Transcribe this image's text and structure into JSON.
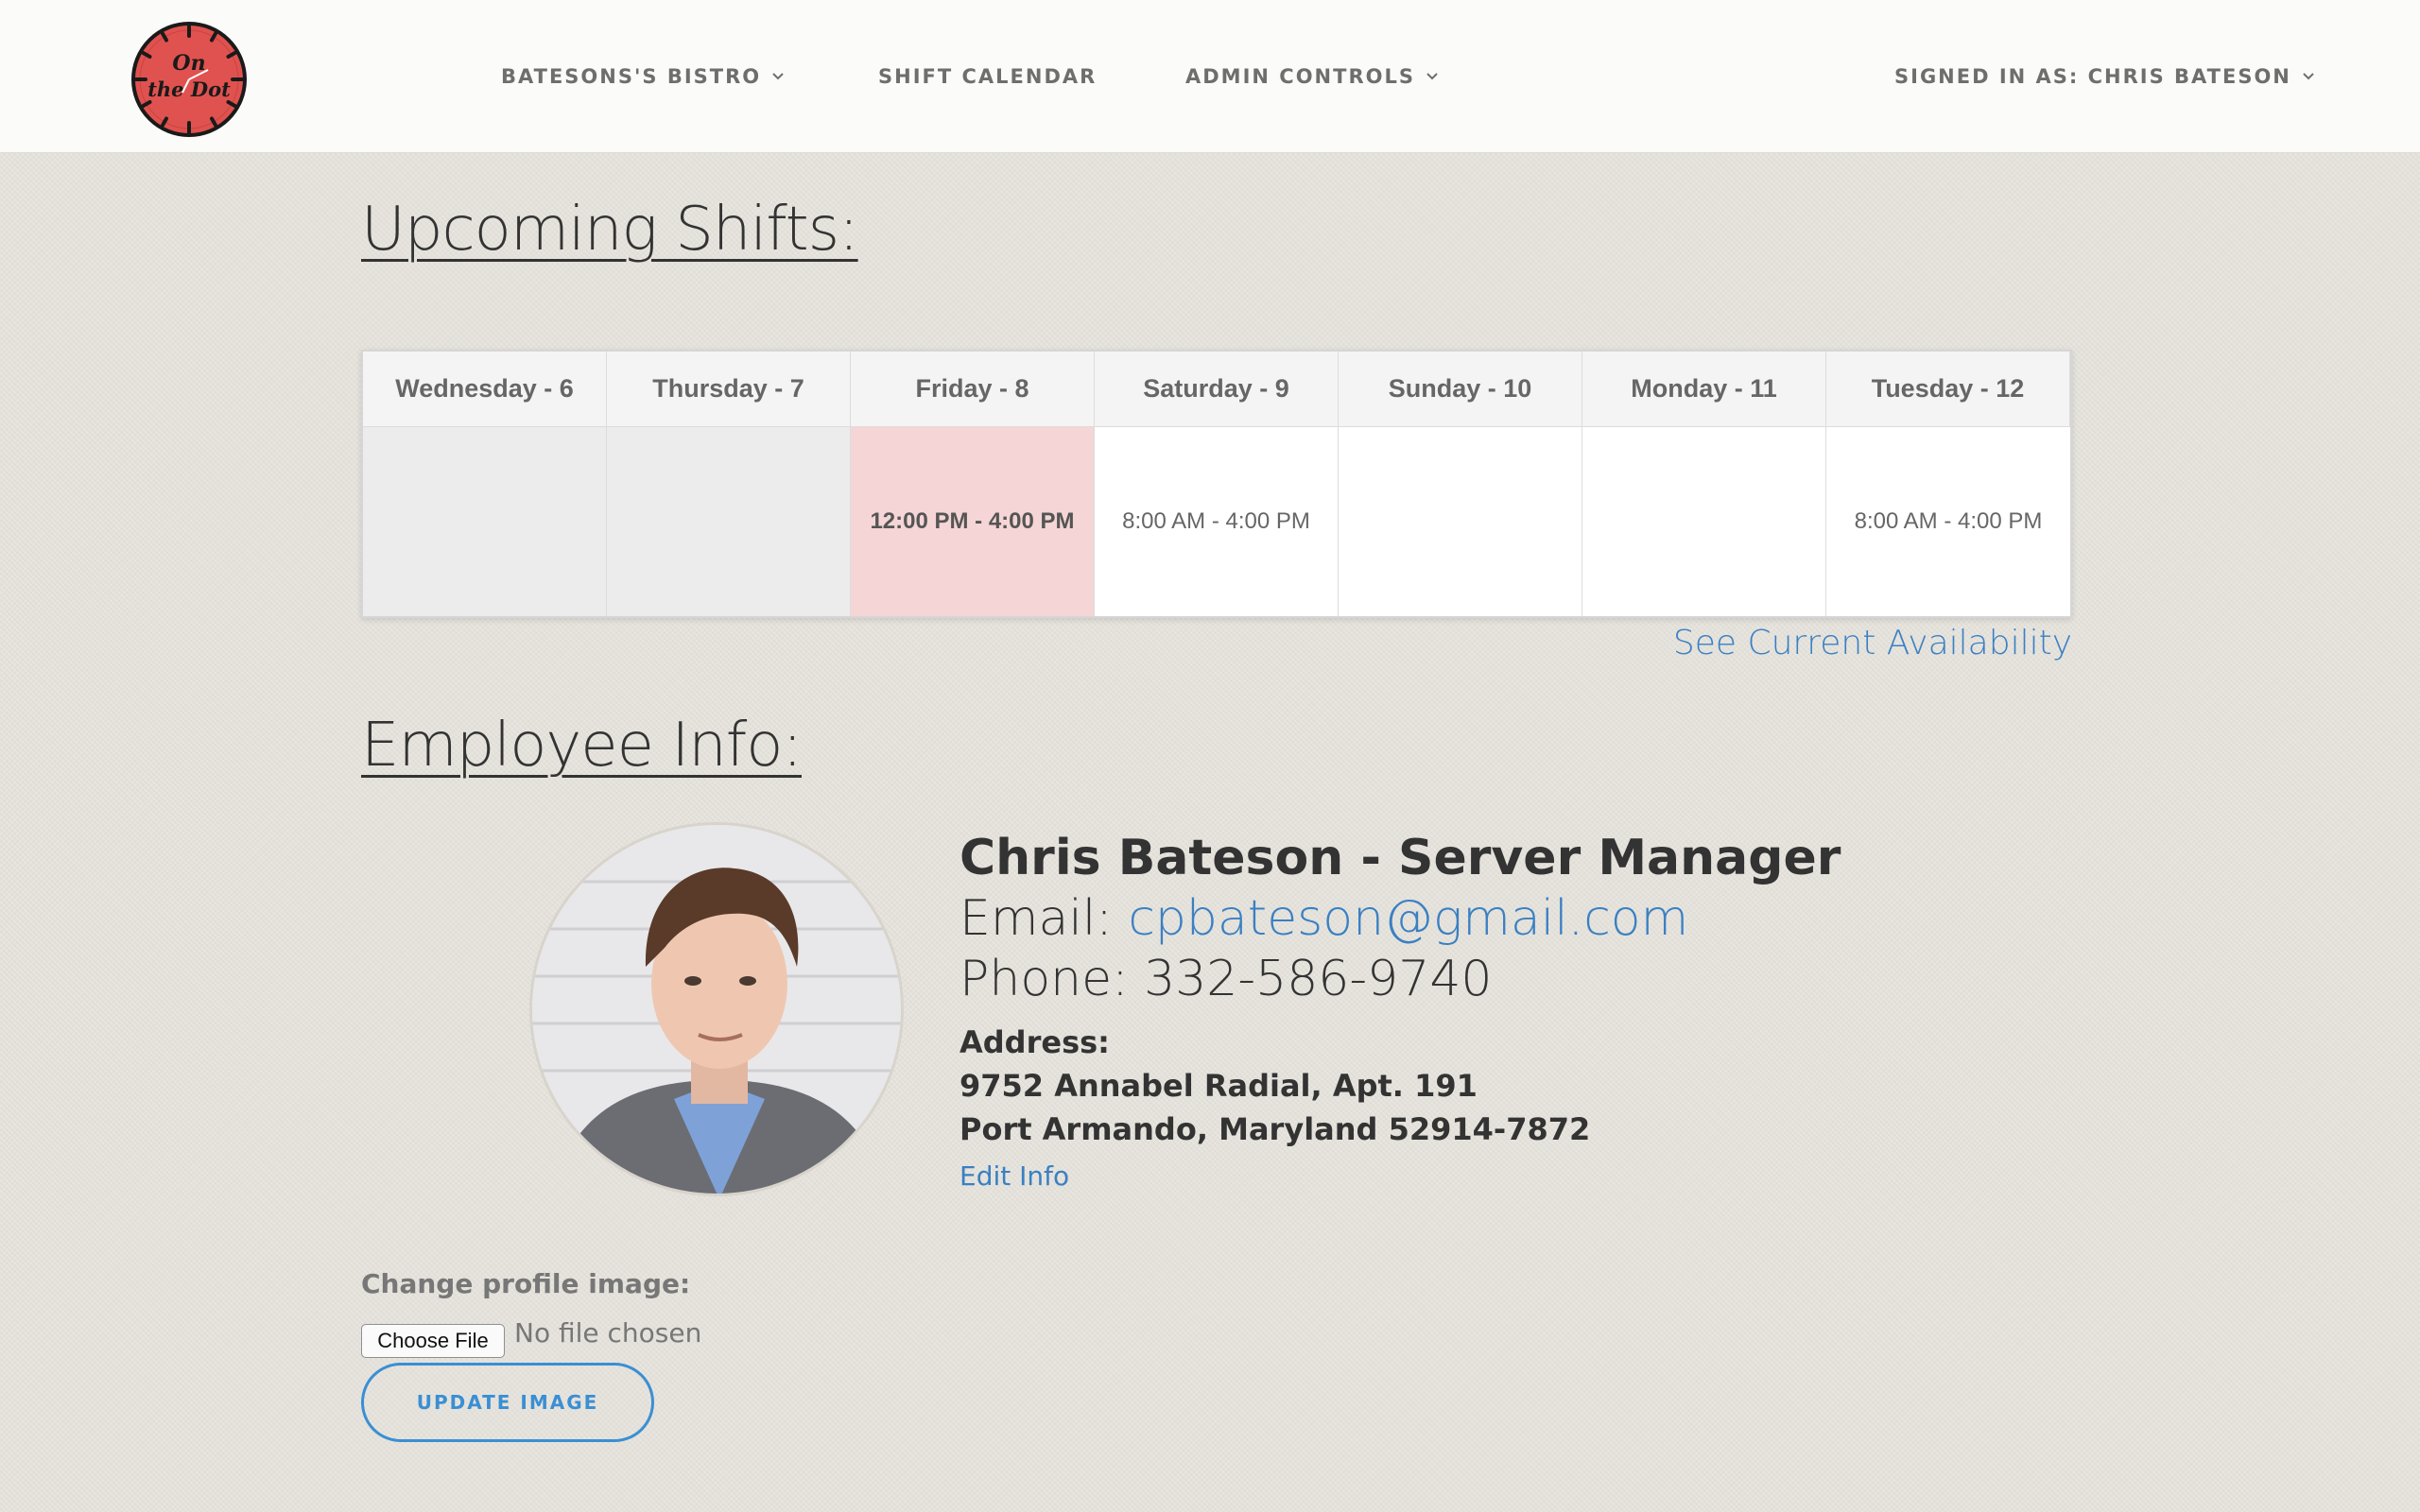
{
  "nav": {
    "logo_text_line1": "On",
    "logo_text_line2": "the Dot",
    "restaurant": "BATESONS'S BISTRO",
    "shift_calendar": "SHIFT CALENDAR",
    "admin_controls": "ADMIN CONTROLS",
    "signed_in": "SIGNED IN AS: CHRIS BATESON"
  },
  "shifts": {
    "title": "Upcoming Shifts:",
    "days": [
      {
        "label": "Wednesday - 6",
        "shift": "",
        "state": "past"
      },
      {
        "label": "Thursday - 7",
        "shift": "",
        "state": "past"
      },
      {
        "label": "Friday - 8",
        "shift": "12:00 PM - 4:00 PM",
        "state": "today"
      },
      {
        "label": "Saturday - 9",
        "shift": "8:00 AM - 4:00 PM",
        "state": "upcoming"
      },
      {
        "label": "Sunday - 10",
        "shift": "",
        "state": "upcoming"
      },
      {
        "label": "Monday - 11",
        "shift": "",
        "state": "upcoming"
      },
      {
        "label": "Tuesday - 12",
        "shift": "8:00 AM - 4:00 PM",
        "state": "upcoming"
      }
    ],
    "availability_link": "See Current Availability"
  },
  "employee": {
    "title": "Employee Info:",
    "name_role": "Chris Bateson - Server Manager",
    "email_label": "Email: ",
    "email": "cpbateson@gmail.com",
    "phone": "Phone: 332-586-9740",
    "address_label": "Address:",
    "address_line1": "9752 Annabel Radial, Apt. 191",
    "address_line2": "Port Armando, Maryland 52914-7872",
    "edit_link": "Edit Info"
  },
  "upload": {
    "label": "Change profile image:",
    "choose_file": "Choose File",
    "status": "No file chosen",
    "submit": "UPDATE IMAGE"
  },
  "colors": {
    "accent": "#3a80c2",
    "today_bg": "#f5d5d5",
    "past_bg": "#ececec",
    "logo_red": "#e0524f"
  },
  "icons": [
    "clock-logo-icon",
    "chevron-down-icon",
    "avatar-photo"
  ]
}
